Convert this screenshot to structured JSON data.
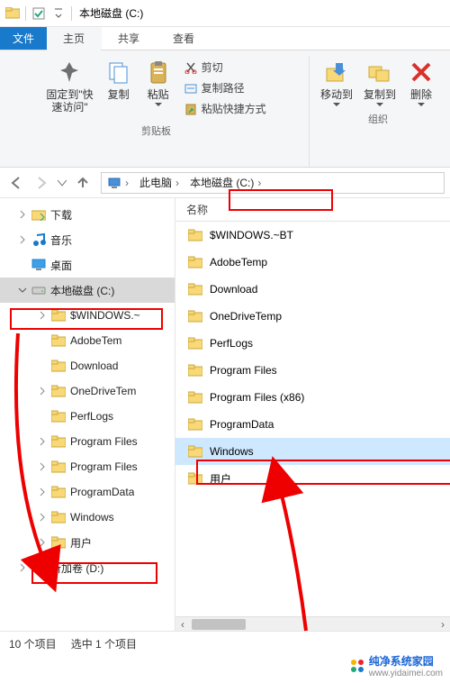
{
  "titlebar": {
    "title": "本地磁盘 (C:)"
  },
  "tabs": {
    "file": "文件",
    "home": "主页",
    "share": "共享",
    "view": "查看"
  },
  "ribbon": {
    "clipboard": {
      "pin": "固定到\"快\n速访问\"",
      "copy": "复制",
      "paste": "粘贴",
      "cut": "剪切",
      "copypath": "复制路径",
      "pasteshortcut": "粘贴快捷方式",
      "label": "剪贴板"
    },
    "organize": {
      "moveto": "移动到",
      "copyto": "复制到",
      "delete": "删除",
      "label": "组织"
    }
  },
  "address": {
    "thispc": "此电脑",
    "drive": "本地磁盘 (C:)"
  },
  "list": {
    "header_name": "名称",
    "items": [
      "$WINDOWS.~BT",
      "AdobeTemp",
      "Download",
      "OneDriveTemp",
      "PerfLogs",
      "Program Files",
      "Program Files (x86)",
      "ProgramData",
      "Windows",
      "用户"
    ],
    "selected_index": 8
  },
  "tree": {
    "items": [
      {
        "label": "下载",
        "indent": 1,
        "icon": "folder-blue",
        "exp": ">"
      },
      {
        "label": "音乐",
        "indent": 1,
        "icon": "music",
        "exp": ">"
      },
      {
        "label": "桌面",
        "indent": 1,
        "icon": "desktop",
        "exp": ""
      },
      {
        "label": "本地磁盘 (C:)",
        "indent": 1,
        "icon": "drive",
        "exp": "v",
        "sel": true
      },
      {
        "label": "$WINDOWS.~",
        "indent": 2,
        "icon": "folder",
        "exp": ">"
      },
      {
        "label": "AdobeTem",
        "indent": 2,
        "icon": "folder",
        "exp": ""
      },
      {
        "label": "Download",
        "indent": 2,
        "icon": "folder",
        "exp": ""
      },
      {
        "label": "OneDriveTem",
        "indent": 2,
        "icon": "folder",
        "exp": ">"
      },
      {
        "label": "PerfLogs",
        "indent": 2,
        "icon": "folder",
        "exp": ""
      },
      {
        "label": "Program Files",
        "indent": 2,
        "icon": "folder",
        "exp": ">"
      },
      {
        "label": "Program Files",
        "indent": 2,
        "icon": "folder",
        "exp": ">"
      },
      {
        "label": "ProgramData",
        "indent": 2,
        "icon": "folder",
        "exp": ">"
      },
      {
        "label": "Windows",
        "indent": 2,
        "icon": "folder",
        "exp": ">"
      },
      {
        "label": "用户",
        "indent": 2,
        "icon": "folder",
        "exp": ">"
      },
      {
        "label": "新加卷 (D:)",
        "indent": 1,
        "icon": "drive",
        "exp": ">"
      }
    ]
  },
  "status": {
    "count": "10 个项目",
    "selected": "选中 1 个项目"
  },
  "watermark": {
    "brand": "纯净系统家园",
    "url": "www.yidaimei.com"
  }
}
